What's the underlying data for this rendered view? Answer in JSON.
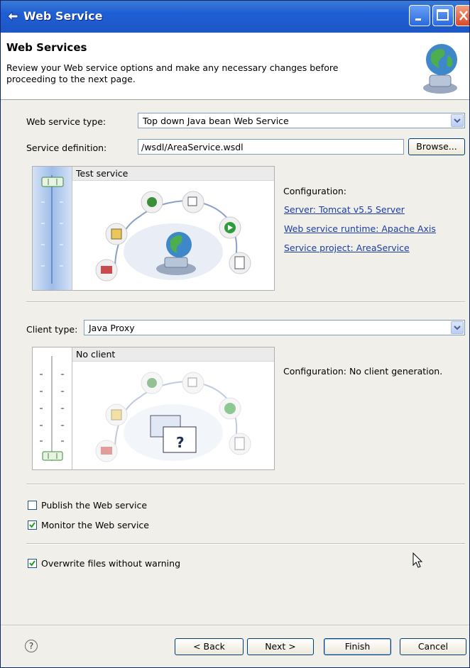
{
  "window": {
    "title": "Web Service"
  },
  "header": {
    "title": "Web Services",
    "description": "Review your Web service options and make any necessary changes before proceeding to the next page."
  },
  "service": {
    "type_label": "Web service type:",
    "type_value": "Top down Java bean Web Service",
    "definition_label": "Service definition:",
    "definition_value": "/wsdl/AreaService.wsdl",
    "browse_label": "Browse...",
    "panel_title": "Test service",
    "slider_level": "Test service",
    "config_label": "Configuration:",
    "links": [
      "Server: Tomcat v5.5 Server",
      "Web service runtime: Apache Axis",
      "Service project: AreaService"
    ]
  },
  "client": {
    "type_label": "Client type:",
    "type_value": "Java Proxy",
    "panel_title": "No client",
    "slider_level": "No client",
    "config_label": "Configuration: No client generation."
  },
  "options": {
    "publish": {
      "label": "Publish the Web service",
      "checked": false
    },
    "monitor": {
      "label": "Monitor the Web service",
      "checked": true
    },
    "overwrite": {
      "label": "Overwrite files without warning",
      "checked": true
    }
  },
  "footer": {
    "help_icon": "?",
    "back": "< Back",
    "next": "Next >",
    "finish": "Finish",
    "cancel": "Cancel"
  },
  "colors": {
    "titlebar": "#1e5ed4",
    "link": "#1b3da8",
    "dialog_bg": "#f0efe9"
  }
}
